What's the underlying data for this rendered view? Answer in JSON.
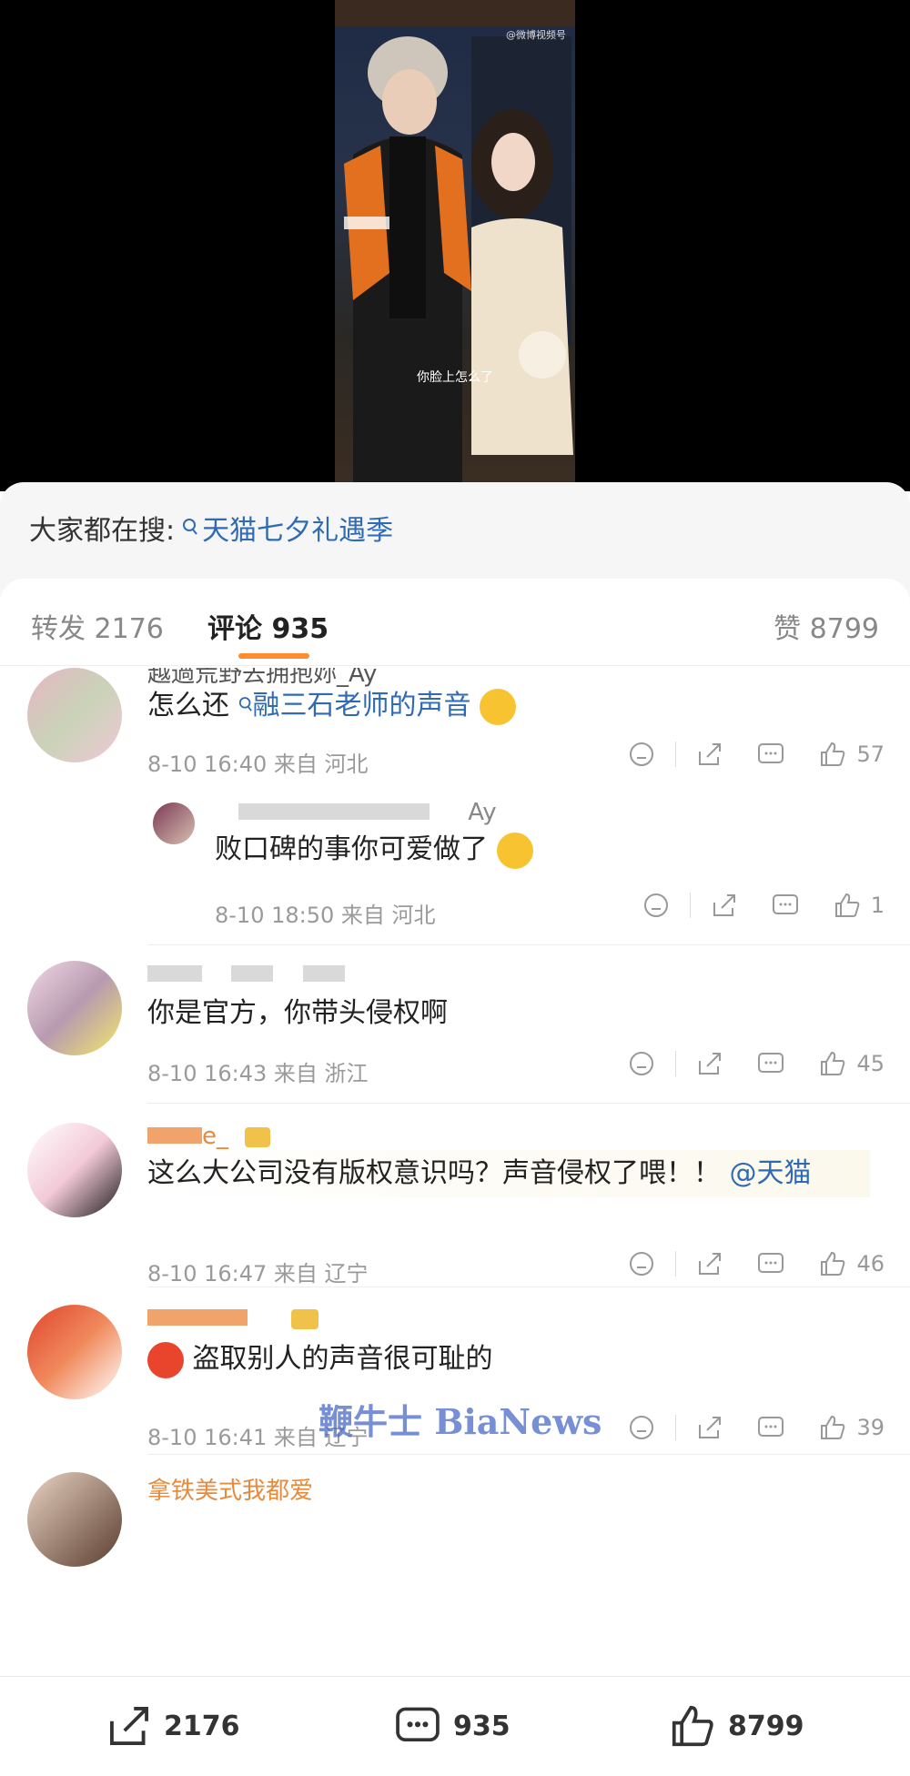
{
  "video": {
    "watermark": "@微博视频号",
    "subtitle": "你脸上怎么了"
  },
  "search": {
    "prefix": "大家都在搜:",
    "query": "天猫七夕礼遇季"
  },
  "tabs": {
    "repost": "转发 2176",
    "comment": "评论 935",
    "like": "赞 8799"
  },
  "comments": [
    {
      "name": "越過荒野去拥抱妳_Ay",
      "text_prefix": "怎么还",
      "text_link": "融三石老师的声音",
      "time": "8-10 16:40 来自 河北",
      "likes": "57"
    },
    {
      "name_suffix": "Ay",
      "text": "败口碑的事你可爱做了",
      "time": "8-10 18:50 来自 河北",
      "likes": "1"
    },
    {
      "text": "你是官方，你带头侵权啊",
      "time": "8-10 16:43 来自 浙江",
      "likes": "45"
    },
    {
      "name_suffix": "e_",
      "text": "这么大公司没有版权意识吗？声音侵权了喂！！",
      "mention": "@天猫",
      "time": "8-10 16:47 来自 辽宁",
      "likes": "46"
    },
    {
      "text": "盗取别人的声音很可耻的",
      "time": "8-10 16:41 来自 辽宁",
      "likes": "39"
    },
    {
      "name": "拿铁美式我都爱"
    }
  ],
  "watermark_text": "鞭牛士 BiaNews",
  "bottom": {
    "repost": "2176",
    "comment": "935",
    "like": "8799"
  }
}
